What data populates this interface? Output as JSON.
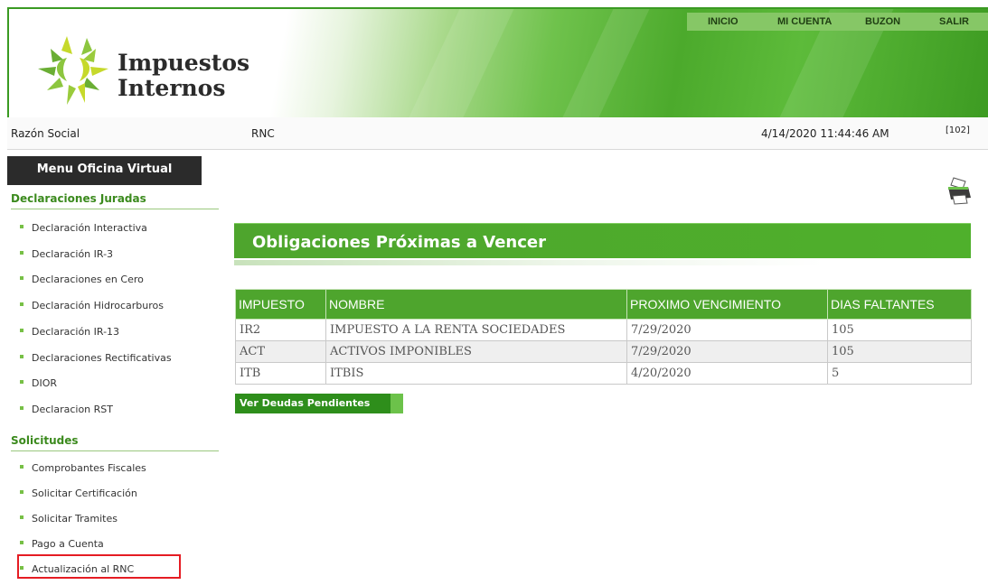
{
  "brand": {
    "line1": "Impuestos",
    "line2": "Internos"
  },
  "nav": {
    "home": "INICIO",
    "account": "MI CUENTA",
    "inbox": "BUZON",
    "logout": "SALIR"
  },
  "info": {
    "razon_social": "Razón Social",
    "rnc": "RNC",
    "datetime": "4/14/2020 11:44:46 AM",
    "code": "[102]"
  },
  "sidebar": {
    "title": "Menu Oficina Virtual",
    "sections": [
      {
        "label": "Declaraciones Juradas",
        "items": [
          "Declaración Interactiva",
          "Declaración IR-3",
          "Declaraciones en Cero",
          "Declaración Hidrocarburos",
          "Declaración IR-13",
          "Declaraciones Rectificativas",
          "DIOR",
          "Declaracion RST"
        ]
      },
      {
        "label": "Solicitudes",
        "items": [
          "Comprobantes Fiscales",
          "Solicitar Certificación",
          "Solicitar Tramites",
          "Pago a Cuenta",
          "Actualización al RNC"
        ]
      }
    ]
  },
  "main": {
    "banner_title": "Obligaciones Próximas a Vencer",
    "table": {
      "headers": [
        "IMPUESTO",
        "NOMBRE",
        "PROXIMO VENCIMIENTO",
        "DIAS FALTANTES"
      ],
      "rows": [
        [
          "IR2",
          "IMPUESTO A LA RENTA SOCIEDADES",
          "7/29/2020",
          "105"
        ],
        [
          "ACT",
          "ACTIVOS IMPONIBLES",
          "7/29/2020",
          "105"
        ],
        [
          "ITB",
          "ITBIS",
          "4/20/2020",
          "5"
        ]
      ]
    },
    "button_label": "Ver Deudas Pendientes"
  },
  "icons": {
    "printer": "printer-icon",
    "logo": "sun-logo-icon"
  },
  "colors": {
    "primary_green": "#4ea52d",
    "dark_green": "#2e8e1b",
    "highlight": "#e51c23"
  }
}
